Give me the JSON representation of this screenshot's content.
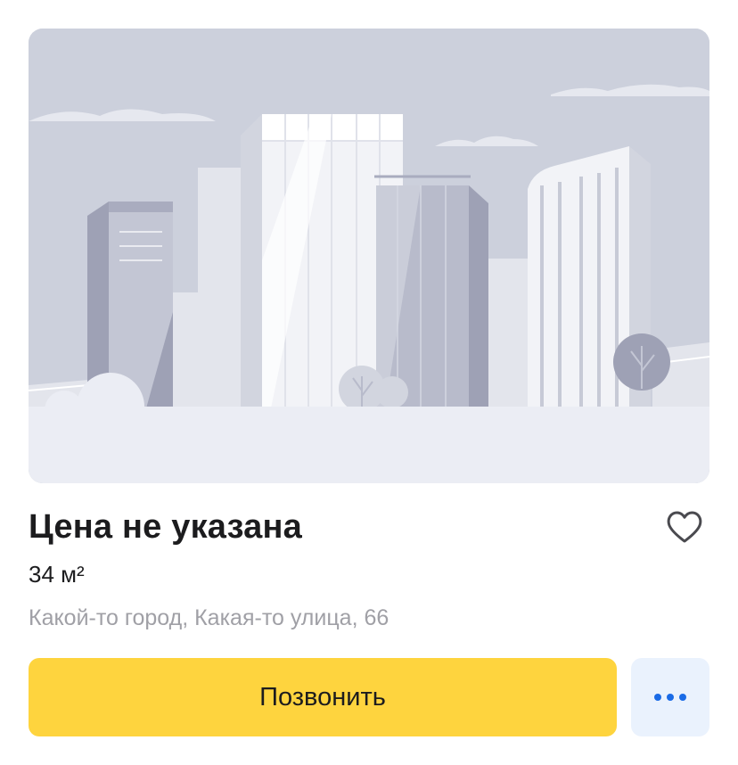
{
  "listing": {
    "price": "Цена не указана",
    "area": "34 м²",
    "address": "Какой-то город, Какая-то улица, 66",
    "favorite_icon": "heart-outline-icon",
    "photo_icon": "city-placeholder-illustration"
  },
  "actions": {
    "call_label": "Позвонить",
    "more_icon": "more-dots-icon"
  },
  "colors": {
    "call_button": "#fed43e",
    "more_button_bg": "#eaf2fd",
    "more_dots": "#1a6be6",
    "address_text": "#a0a0a6",
    "placeholder_sky": "#ccd0dc",
    "placeholder_ground": "#ebedf4"
  }
}
